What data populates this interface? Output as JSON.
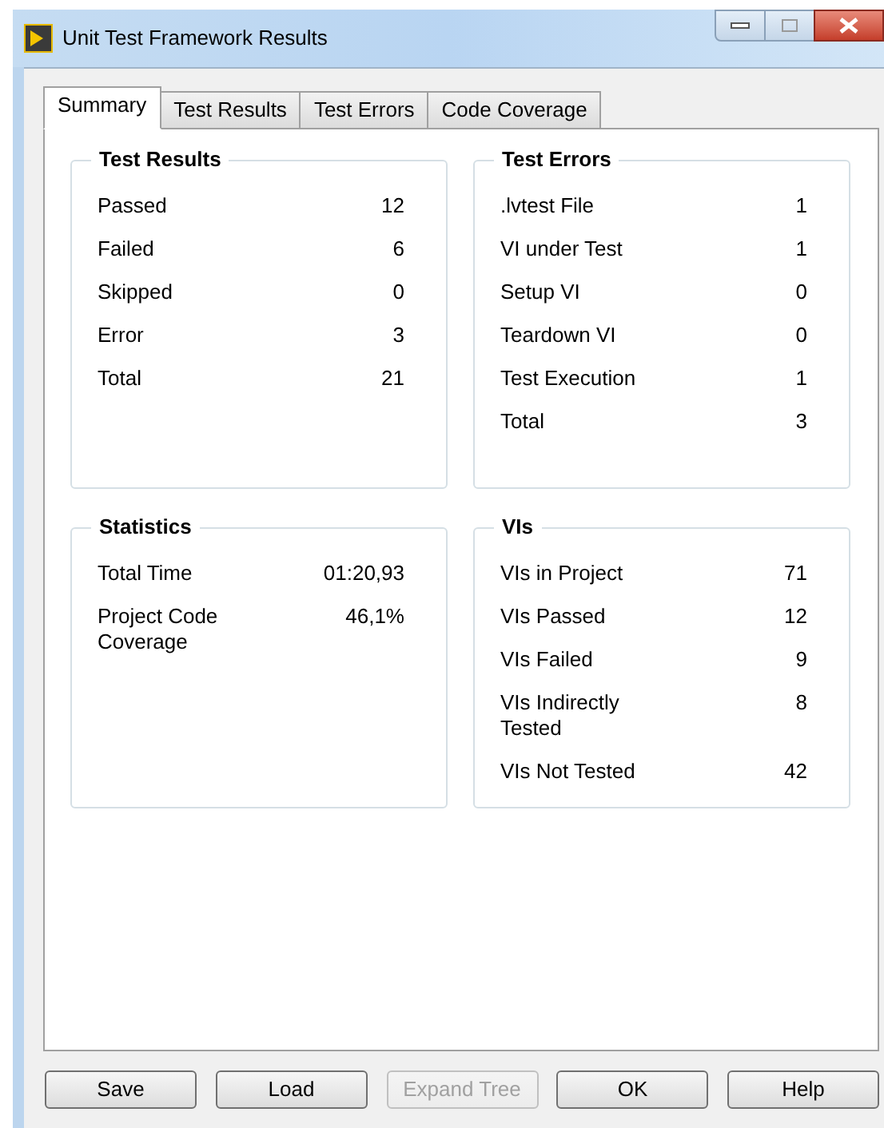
{
  "window": {
    "title": "Unit Test Framework Results"
  },
  "tabs": [
    {
      "label": "Summary",
      "selected": true
    },
    {
      "label": "Test Results",
      "selected": false
    },
    {
      "label": "Test Errors",
      "selected": false
    },
    {
      "label": "Code Coverage",
      "selected": false
    }
  ],
  "groups": [
    {
      "title": "Test Results",
      "rows": [
        {
          "label": "Passed",
          "value": "12"
        },
        {
          "label": "Failed",
          "value": "6"
        },
        {
          "label": "Skipped",
          "value": "0"
        },
        {
          "label": "Error",
          "value": "3"
        },
        {
          "label": "Total",
          "value": "21"
        }
      ]
    },
    {
      "title": "Test Errors",
      "rows": [
        {
          "label": ".lvtest File",
          "value": "1"
        },
        {
          "label": "VI under Test",
          "value": "1"
        },
        {
          "label": "Setup VI",
          "value": "0"
        },
        {
          "label": "Teardown VI",
          "value": "0"
        },
        {
          "label": "Test Execution",
          "value": "1"
        },
        {
          "label": "Total",
          "value": "3"
        }
      ]
    },
    {
      "title": "Statistics",
      "rows": [
        {
          "label": "Total Time",
          "value": "01:20,93"
        },
        {
          "label": "Project Code Coverage",
          "value": "46,1%"
        }
      ]
    },
    {
      "title": "VIs",
      "rows": [
        {
          "label": "VIs in Project",
          "value": "71"
        },
        {
          "label": "VIs Passed",
          "value": "12"
        },
        {
          "label": "VIs Failed",
          "value": "9"
        },
        {
          "label": "VIs Indirectly Tested",
          "value": "8"
        },
        {
          "label": "VIs Not Tested",
          "value": "42"
        }
      ]
    }
  ],
  "buttons": [
    {
      "label": "Save",
      "disabled": false
    },
    {
      "label": "Load",
      "disabled": false
    },
    {
      "label": "Expand Tree",
      "disabled": true
    },
    {
      "label": "OK",
      "disabled": false
    },
    {
      "label": "Help",
      "disabled": false
    }
  ]
}
